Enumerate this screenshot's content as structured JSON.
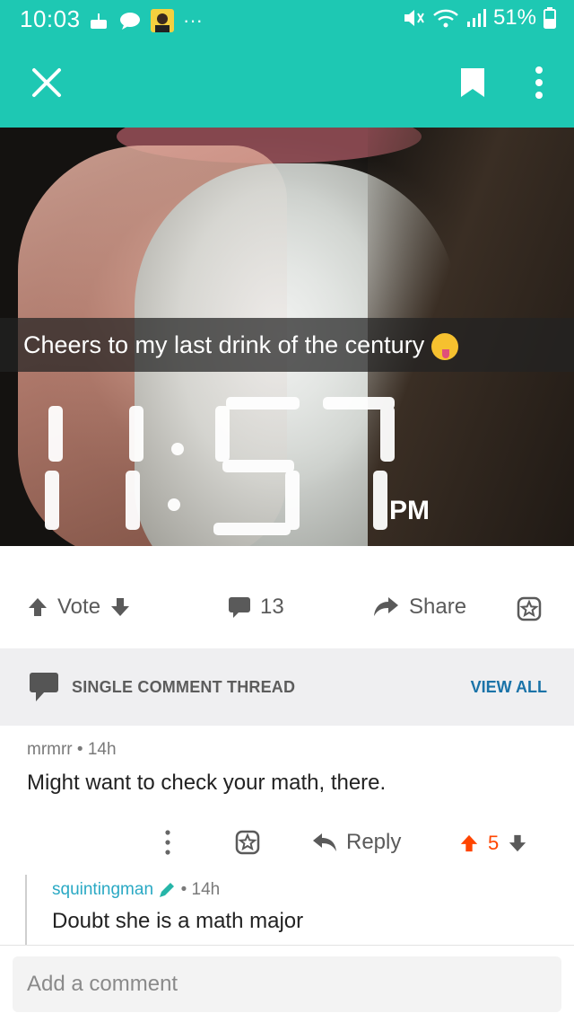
{
  "status_bar": {
    "time": "10:03",
    "battery": "51%",
    "overflow": "···",
    "icons": [
      "cake-icon",
      "message-bubble-icon",
      "avatar-notification-icon",
      "mute-icon",
      "wifi-icon",
      "signal-icon",
      "battery-icon"
    ]
  },
  "toolbar": {
    "close_icon": "close-icon",
    "bookmark_icon": "bookmark-icon",
    "more_icon": "more-vertical-icon",
    "color": "#1ec8b3"
  },
  "post_image": {
    "caption": "Cheers to my last drink of the century",
    "clock_digits": "11:57",
    "clock_suffix": "PM"
  },
  "post_actions": {
    "vote_label": "Vote",
    "comment_count": "13",
    "share_label": "Share"
  },
  "thread_bar": {
    "label": "SINGLE COMMENT THREAD",
    "view_all": "VIEW ALL"
  },
  "comments": [
    {
      "author": "mrmrr",
      "separator": "•",
      "age": "14h",
      "body": "Might want to check your math, there.",
      "reply_label": "Reply",
      "score": "5",
      "score_color": "#ff4500"
    },
    {
      "author": "squintingman",
      "separator": "•",
      "age": "14h",
      "body": "Doubt she is a math major",
      "author_color": "#2aa9c4"
    }
  ],
  "composer": {
    "placeholder": "Add a comment"
  }
}
